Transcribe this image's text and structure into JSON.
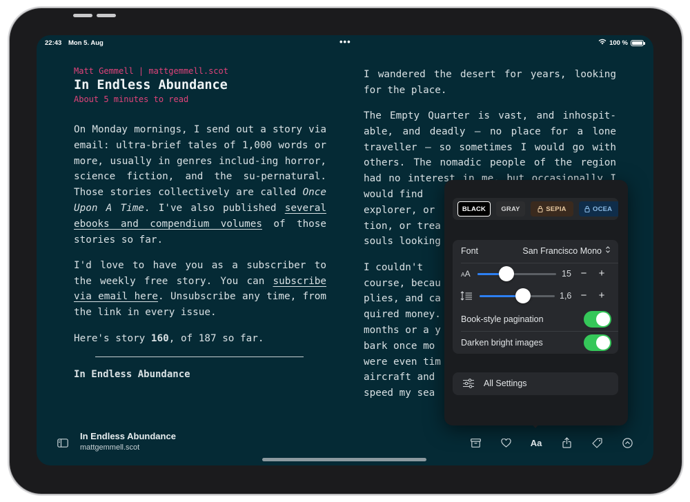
{
  "status_bar": {
    "time": "22:43",
    "date": "Mon 5. Aug",
    "more_dots": "•••",
    "battery_text": "100 %"
  },
  "article": {
    "byline": "Matt Gemmell | mattgemmell.scot",
    "title": "In Endless Abundance",
    "read_time": "About 5 minutes to read",
    "p1": {
      "a": "On Monday mornings, I send out a story via email: ultra-brief tales of 1,000 words or more, usually in genres includ-ing horror, science fiction, and the su-pernatural. Those stories collectively are called ",
      "em": "Once Upon A Time",
      "b": ". I've also published ",
      "link": "several ebooks and compendium volumes",
      "c": " of those stories so far."
    },
    "p2": {
      "a": "I'd love to have you as a subscriber to the weekly free story. You can ",
      "link": "subscribe via email here",
      "b": ". Unsubscribe any time, from the link in every issue."
    },
    "p3": {
      "a": "Here's story ",
      "num": "160",
      "b": ", of 187 so far."
    },
    "section_title": "In Endless Abundance",
    "r1": "I wandered the desert for years, looking for the place.",
    "r2": "The Empty Quarter is vast, and inhospit-able, and deadly — no place for a lone traveller — so sometimes I would go with others. The nomadic people of the region had no interest in me, but occasionally I would find",
    "r2_tail": [
      "explorer, or",
      "tion, or trea",
      "souls looking"
    ],
    "r3": [
      "I  couldn't",
      "course, becau",
      "plies, and ca",
      "quired money.",
      "months or a y",
      "bark once mo",
      "were even tim",
      "aircraft and",
      "speed my sea"
    ]
  },
  "popover": {
    "themes": [
      {
        "label": "BLACK",
        "bg": "#000000",
        "fg": "#ffffff",
        "locked": false,
        "selected": true
      },
      {
        "label": "GRAY",
        "bg": "#2c2d2f",
        "fg": "#d6d6d6",
        "locked": false,
        "selected": false
      },
      {
        "label": "SEPIA",
        "bg": "#3a2a1e",
        "fg": "#e8c9a0",
        "locked": true,
        "selected": false
      },
      {
        "label": "OCEA",
        "bg": "#0f2d4a",
        "fg": "#8bbbe6",
        "locked": true,
        "selected": false
      }
    ],
    "font_label": "Font",
    "font_value": "San Francisco Mono",
    "text_size": {
      "value": "15",
      "level": 0.37
    },
    "line_spacing": {
      "value": "1,6",
      "level": 0.58
    },
    "minus": "−",
    "plus": "+",
    "pagination_label": "Book-style pagination",
    "pagination_on": true,
    "darken_label": "Darken bright images",
    "darken_on": true,
    "all_settings": "All Settings",
    "accent_color": "#2d7ff2",
    "toggle_color": "#35c759"
  },
  "bottom_bar": {
    "title": "In Endless Abundance",
    "subtitle": "mattgemmell.scot",
    "sidebar_icon": "sidebar-icon",
    "archive_icon": "archive-icon",
    "heart_icon": "heart-icon",
    "aa_label": "Aa",
    "share_icon": "share-icon",
    "tag_icon": "tag-icon",
    "more_icon": "chevron-up-circle-icon"
  }
}
